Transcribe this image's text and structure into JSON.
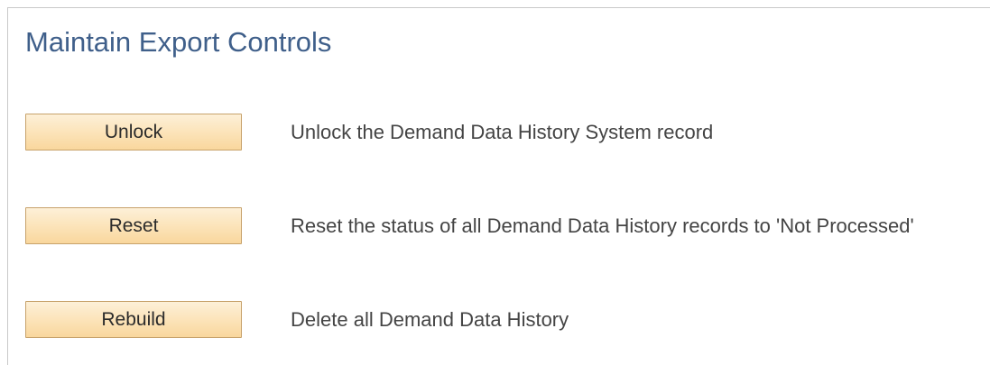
{
  "page": {
    "title": "Maintain Export Controls"
  },
  "actions": [
    {
      "button_label": "Unlock",
      "description": "Unlock the Demand Data History System record"
    },
    {
      "button_label": "Reset",
      "description": "Reset the status of all Demand Data History records to 'Not Processed'"
    },
    {
      "button_label": "Rebuild",
      "description": "Delete all Demand Data History"
    }
  ],
  "colors": {
    "title": "#3f5f8a",
    "button_fill": "#fce5bd",
    "button_border": "#c7a26b",
    "text": "#444444"
  }
}
